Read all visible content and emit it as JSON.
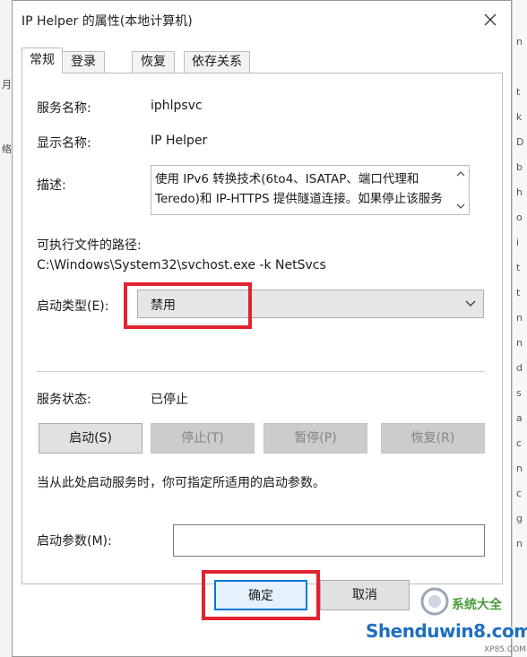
{
  "background": {
    "left_glyphs": [
      "月",
      "络"
    ],
    "right_glyphs": [
      "n",
      "t",
      "k",
      "D",
      "b",
      "h",
      "o",
      "i",
      "t",
      "t",
      "n",
      "n",
      "d",
      "s",
      "a",
      "c",
      "n",
      "c",
      "g",
      "n"
    ]
  },
  "window": {
    "title": "IP Helper 的属性(本地计算机)",
    "close_icon": "close-icon"
  },
  "tabs": [
    {
      "label": "常规",
      "active": true
    },
    {
      "label": "登录",
      "active": false
    },
    {
      "label": "恢复",
      "active": false
    },
    {
      "label": "依存关系",
      "active": false
    }
  ],
  "general": {
    "service_name_label": "服务名称:",
    "service_name_value": "iphlpsvc",
    "display_name_label": "显示名称:",
    "display_name_value": "IP Helper",
    "description_label": "描述:",
    "description_text": "使用 IPv6 转换技术(6to4、ISATAP、端口代理和\nTeredo)和 IP-HTTPS 提供隧道连接。如果停止该服务",
    "path_label": "可执行文件的路径:",
    "path_value": "C:\\Windows\\System32\\svchost.exe -k NetSvcs",
    "startup_type_label": "启动类型(E):",
    "startup_type_value": "禁用",
    "service_status_label": "服务状态:",
    "service_status_value": "已停止",
    "buttons": {
      "start": "启动(S)",
      "stop": "停止(T)",
      "pause": "暂停(P)",
      "resume": "恢复(R)"
    },
    "hint_text": "当从此处启动服务时，你可指定所适用的启动参数。",
    "start_params_label": "启动参数(M):",
    "start_params_value": ""
  },
  "footer": {
    "ok_label": "确定",
    "cancel_label": "取消"
  },
  "watermark": {
    "line1": "系统大全",
    "line2": "Shenduwin8.com",
    "line3": "XP85.COM"
  },
  "colors": {
    "highlight_red": "#e0232e",
    "focus_blue": "#0078d7",
    "watermark_blue": "#1f6fc2",
    "watermark_green": "#4a9b3c"
  }
}
